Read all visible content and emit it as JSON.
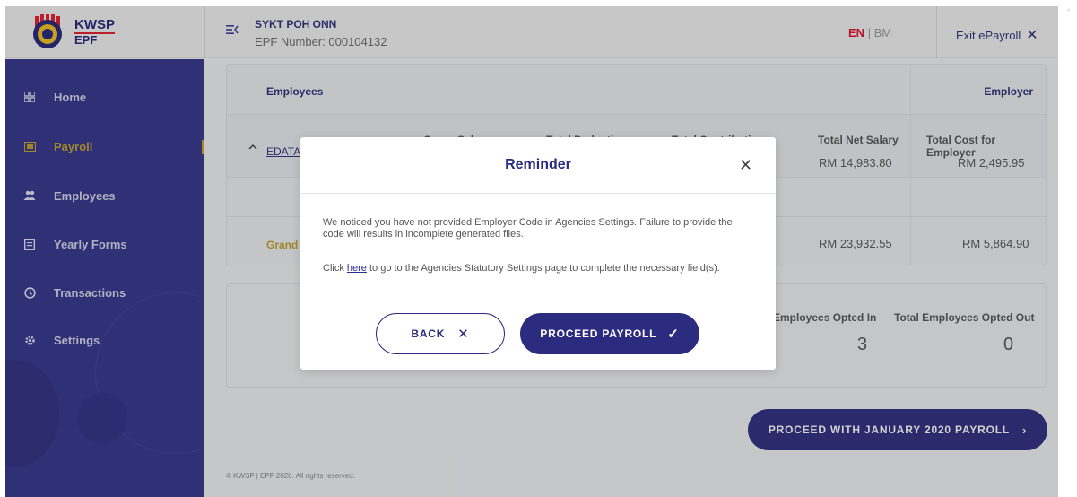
{
  "header": {
    "logo": {
      "line1": "KWSP",
      "line2": "EPF"
    },
    "org_name": "SYKT POH ONN",
    "epf_number": "EPF Number: 000104132",
    "lang_en": "EN",
    "lang_sep": "|",
    "lang_bm": "BM",
    "exit_label": "Exit ePayroll"
  },
  "sidebar": {
    "items": [
      {
        "label": "Home",
        "icon": "dashboard-icon"
      },
      {
        "label": "Payroll",
        "icon": "payroll-icon",
        "active": true
      },
      {
        "label": "Employees",
        "icon": "people-icon"
      },
      {
        "label": "Yearly Forms",
        "icon": "document-icon"
      },
      {
        "label": "Transactions",
        "icon": "history-icon"
      },
      {
        "label": "Settings",
        "icon": "gear-icon"
      }
    ]
  },
  "table": {
    "employees_header": "Employees",
    "employer_header": "Employer",
    "agency_link": "EDATA I",
    "col_gross": "Gross Salary",
    "col_deduction": "Total Deduction",
    "col_contribution": "Total Contribution",
    "col_net": "Total Net Salary",
    "col_cost": "Total Cost for Employer",
    "net_value": "RM 14,983.80",
    "cost_value": "RM 2,495.95",
    "grand_label": "Grand T",
    "grand_net": "RM 23,932.55",
    "grand_cost": "RM 5,864.90"
  },
  "summary": {
    "opted_in_label": "Employees Opted In",
    "opted_in_value": "3",
    "opted_out_label": "Total Employees Opted Out",
    "opted_out_value": "0"
  },
  "proceed_main_label": "PROCEED WITH JANUARY 2020 PAYROLL",
  "footer": {
    "copyright": "© KWSP | EPF 2020. All rights reserved."
  },
  "modal": {
    "title": "Reminder",
    "message1": "We noticed you have not provided Employer Code in Agencies Settings. Failure to provide the code will results in incomplete generated files.",
    "message2_prefix": "Click ",
    "message2_link": "here",
    "message2_suffix": " to go to the Agencies Statutory Settings page to complete the necessary field(s).",
    "back_label": "BACK",
    "proceed_label": "PROCEED PAYROLL"
  },
  "colors": {
    "brand_navy": "#2b2b7f",
    "sidebar_bg": "#32328d",
    "accent_gold": "#c2a22f",
    "lang_active_red": "#e0102a"
  }
}
